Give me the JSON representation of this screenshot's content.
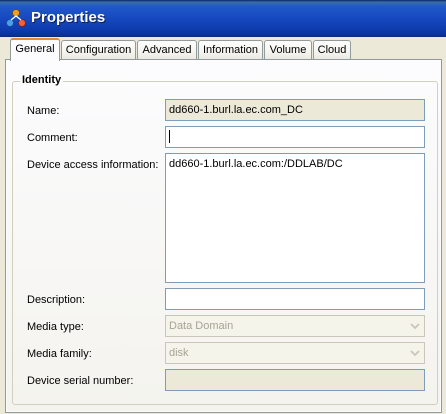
{
  "window": {
    "title": "Properties",
    "icon": "properties-network-icon"
  },
  "tabs": [
    {
      "label": "General",
      "active": true
    },
    {
      "label": "Configuration",
      "active": false
    },
    {
      "label": "Advanced",
      "active": false
    },
    {
      "label": "Information",
      "active": false
    },
    {
      "label": "Volume",
      "active": false
    },
    {
      "label": "Cloud",
      "active": false
    }
  ],
  "identity": {
    "group_label": "Identity",
    "name_label": "Name:",
    "name_value": "dd660-1.burl.la.ec.com_DC",
    "comment_label": "Comment:",
    "comment_value": "",
    "device_access_label": "Device access information:",
    "device_access_value": "dd660-1.burl.la.ec.com:/DDLAB/DC",
    "description_label": "Description:",
    "description_value": "",
    "media_type_label": "Media type:",
    "media_type_value": "Data Domain",
    "media_family_label": "Media family:",
    "media_family_value": "disk",
    "serial_label": "Device serial number:",
    "serial_value": ""
  },
  "colors": {
    "titlebar": "#1749c0",
    "active_tab_accent": "#e68b2c",
    "input_border": "#7f9db9",
    "disabled_text": "#a6a395"
  }
}
